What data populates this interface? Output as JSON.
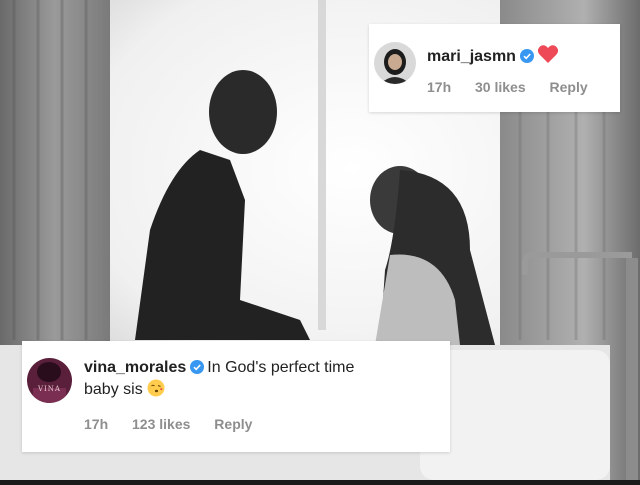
{
  "photo": {
    "description_icon": "couple-bathroom-photo"
  },
  "comments": [
    {
      "username": "mari_jasmn",
      "verified": true,
      "text": "",
      "emoji": "❤️",
      "emoji_icon": "red-heart-icon",
      "time": "17h",
      "likes": "30 likes",
      "reply": "Reply"
    },
    {
      "username": "vina_morales",
      "verified": true,
      "text_line1": "In God's perfect time",
      "text_line2": "baby sis",
      "emoji": "😘",
      "emoji_icon": "kiss-face-icon",
      "time": "17h",
      "likes": "123 likes",
      "reply": "Reply",
      "avatar_text": "VINA"
    }
  ],
  "colors": {
    "verified": "#3897f0",
    "meta": "#8e8e8e",
    "heart": "#ed4956"
  }
}
